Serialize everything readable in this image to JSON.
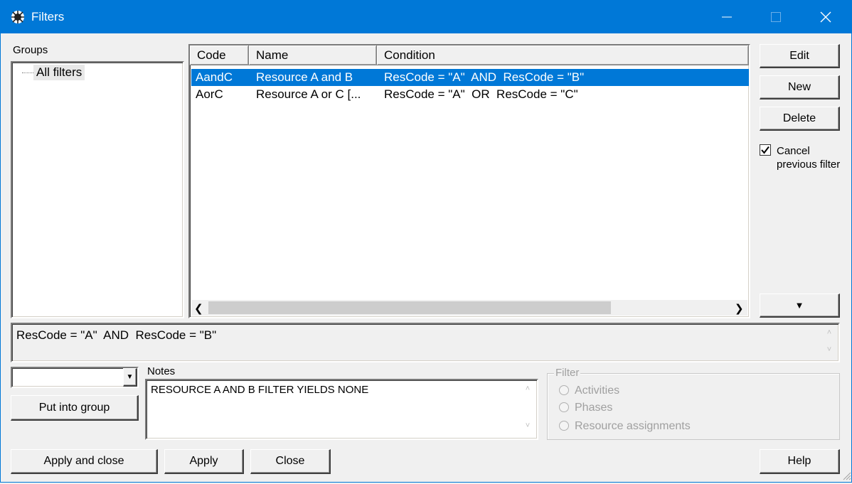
{
  "window": {
    "title": "Filters"
  },
  "groups": {
    "label": "Groups",
    "items": [
      {
        "label": "All filters"
      }
    ]
  },
  "list": {
    "columns": [
      "Code",
      "Name",
      "Condition"
    ],
    "rows": [
      {
        "code": "AandC",
        "name": "Resource A and B",
        "condition": "ResCode = \"A\"  AND  ResCode = \"B\"",
        "selected": true
      },
      {
        "code": "AorC",
        "name": "Resource A or C [...",
        "condition": "ResCode = \"A\"  OR  ResCode = \"C\"",
        "selected": false
      }
    ]
  },
  "side_buttons": {
    "edit": "Edit",
    "new": "New",
    "delete": "Delete",
    "more_glyph": "▼"
  },
  "cancel_previous": {
    "line1": "Cancel",
    "line2": "previous filter",
    "checked": true
  },
  "condition_text": "ResCode = \"A\"  AND  ResCode = \"B\"",
  "group_select": {
    "value": ""
  },
  "put_into_group": "Put into group",
  "notes": {
    "label": "Notes",
    "text": "RESOURCE A AND B FILTER YIELDS NONE"
  },
  "filter_box": {
    "label": "Filter",
    "options": [
      "Activities",
      "Phases",
      "Resource assignments"
    ]
  },
  "bottom_buttons": {
    "apply_close": "Apply and close",
    "apply": "Apply",
    "close": "Close",
    "help": "Help"
  },
  "colors": {
    "titlebar": "#0078d7",
    "selection": "#0078d7"
  }
}
